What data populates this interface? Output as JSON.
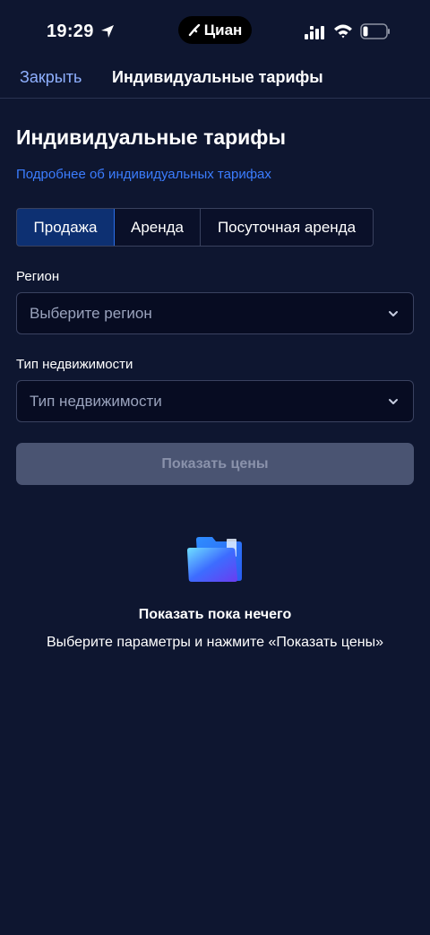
{
  "status_bar": {
    "time": "19:29",
    "app_name": "Циан"
  },
  "nav": {
    "close_label": "Закрыть",
    "title": "Индивидуальные тарифы"
  },
  "page": {
    "title": "Индивидуальные тарифы",
    "more_link": "Подробнее об индивидуальных тарифах"
  },
  "tabs": [
    {
      "label": "Продажа",
      "selected": true
    },
    {
      "label": "Аренда",
      "selected": false
    },
    {
      "label": "Посуточная аренда",
      "selected": false
    }
  ],
  "region": {
    "label": "Регион",
    "placeholder": "Выберите регион"
  },
  "property_type": {
    "label": "Тип недвижимости",
    "placeholder": "Тип недвижимости"
  },
  "show_prices_label": "Показать цены",
  "empty_state": {
    "icon": "folder-icon",
    "title": "Показать пока нечего",
    "subtitle": "Выберите параметры и нажмите «Показать цены»"
  },
  "colors": {
    "background": "#0e1630",
    "accent": "#2c6fe8",
    "link": "#3b7dff",
    "disabled_button": "#4a5472"
  }
}
